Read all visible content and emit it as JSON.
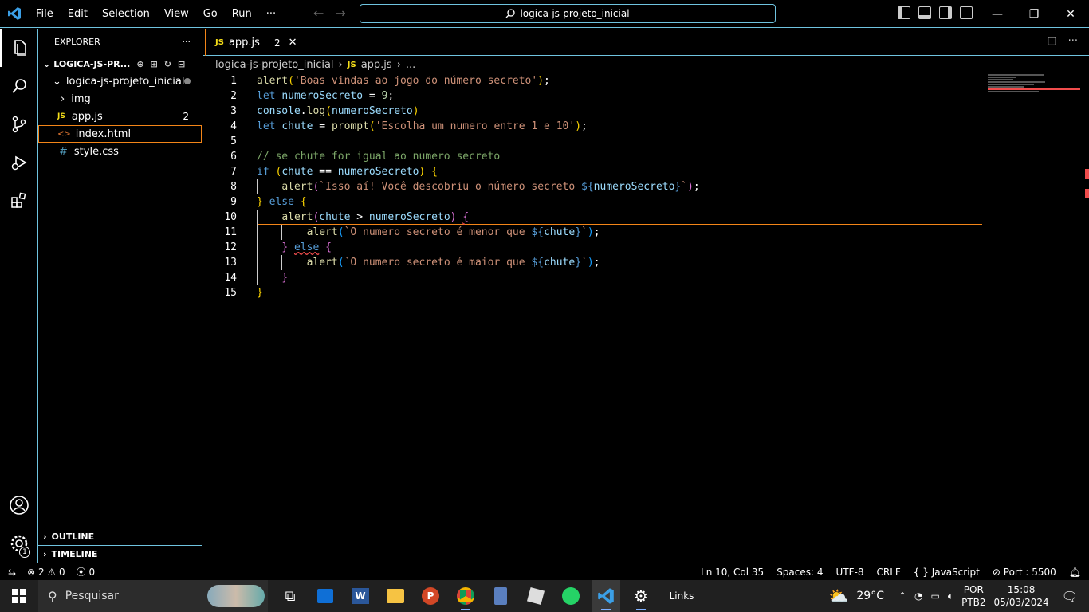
{
  "menu": [
    "File",
    "Edit",
    "Selection",
    "View",
    "Go",
    "Run",
    "···"
  ],
  "search": {
    "text": "logica-js-projeto_inicial"
  },
  "window_controls": {
    "minimize": "—",
    "restore": "❐",
    "close": "✕"
  },
  "explorer": {
    "title": "EXPLORER",
    "more": "···",
    "workspace": "LOGICA-JS-PR...",
    "folder": "logica-js-projeto_inicial",
    "items": [
      {
        "icon": "›",
        "label": "img"
      },
      {
        "icon": "JS",
        "label": "app.js",
        "count": "2"
      },
      {
        "icon": "<>",
        "label": "index.html"
      },
      {
        "icon": "#",
        "label": "style.css"
      }
    ],
    "sections": [
      "OUTLINE",
      "TIMELINE"
    ]
  },
  "tab": {
    "icon": "JS",
    "label": "app.js",
    "count": "2",
    "close": "✕"
  },
  "breadcrumb": {
    "folder": "logica-js-projeto_inicial",
    "icon": "JS",
    "file": "app.js",
    "more": "..."
  },
  "activity_badge": "1",
  "code": {
    "line_numbers": [
      "1",
      "2",
      "3",
      "4",
      "5",
      "6",
      "7",
      "8",
      "9",
      "10",
      "11",
      "12",
      "13",
      "14",
      "15"
    ]
  },
  "status": {
    "errors": "2",
    "warnings": "0",
    "ports": "0",
    "position": "Ln 10, Col 35",
    "spaces": "Spaces: 4",
    "encoding": "UTF-8",
    "eol": "CRLF",
    "language": "JavaScript",
    "port": "Port : 5500"
  },
  "taskbar": {
    "search": "Pesquisar",
    "links": "Links",
    "temp": "29°C",
    "lang1": "POR",
    "lang2": "PTB2",
    "time": "15:08",
    "date": "05/03/2024"
  }
}
